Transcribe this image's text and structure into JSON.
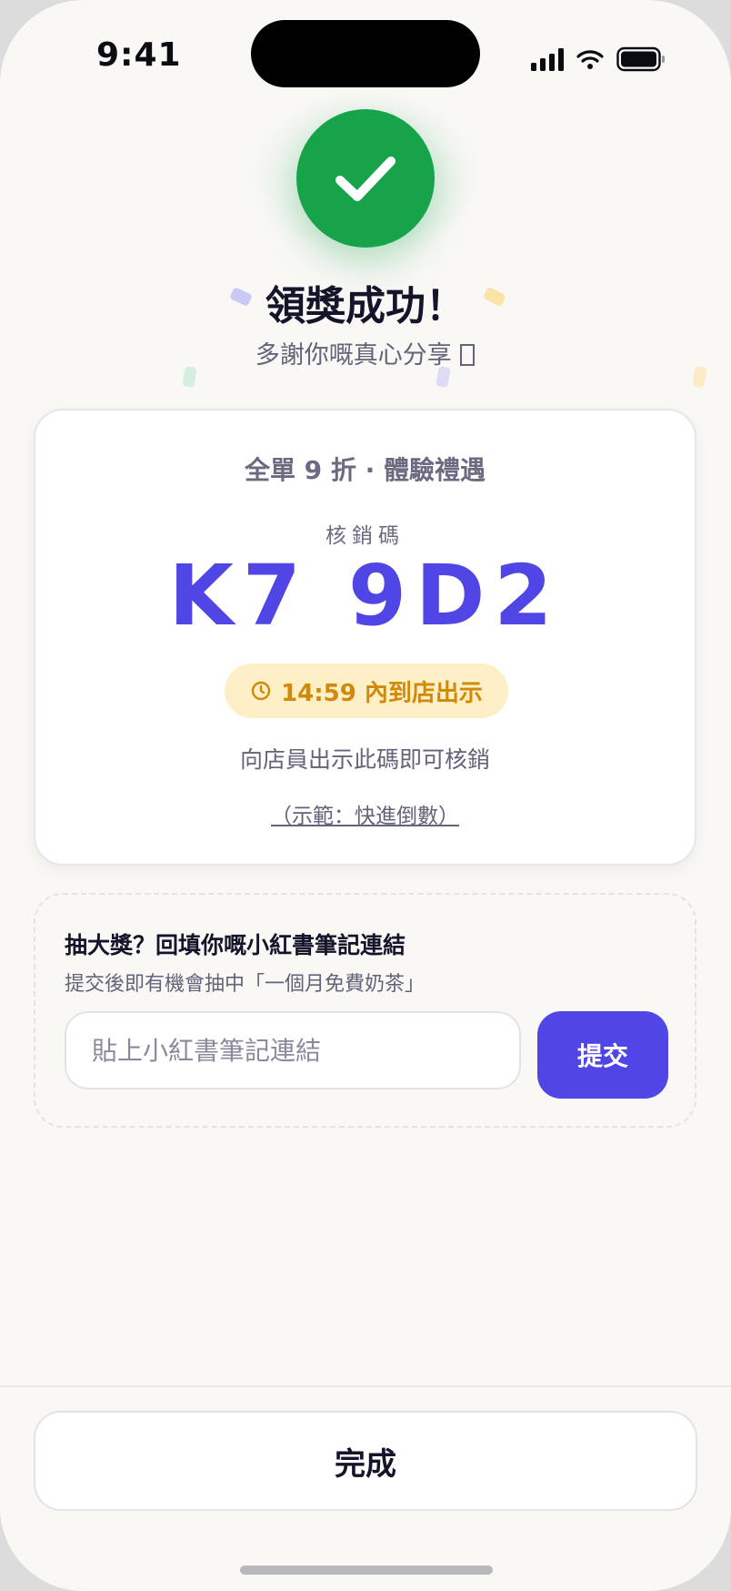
{
  "status_bar": {
    "time": "9:41",
    "icons": [
      "cellular-signal-icon",
      "wifi-icon",
      "battery-icon"
    ]
  },
  "header": {
    "success_icon": "checkmark-icon",
    "title": "領獎成功！",
    "subtitle": "多謝你嘅真心分享 ",
    "subtitle_emoji_icon": "emoji-glyph-icon"
  },
  "voucher": {
    "offer_name": "全單 9 折 · 體驗禮遇",
    "code_label": "核銷碼",
    "code": "K7 9D2",
    "timer_icon": "clock-icon",
    "timer_text": "14:59 內到店出示",
    "instruction": "向店員出示此碼即可核銷",
    "demo_link": "（示範：快進倒數）"
  },
  "lucky_draw": {
    "title": "抽大獎？回填你嘅小紅書筆記連結",
    "description": "提交後即有機會抽中「一個月免費奶茶」",
    "input_value": "",
    "input_placeholder": "貼上小紅書筆記連結",
    "submit_label": "提交"
  },
  "footer": {
    "done_label": "完成"
  },
  "colors": {
    "background": "#f9f8f5",
    "success": "#16a34a",
    "accent": "#4f46e5",
    "timer_bg": "#feefc6",
    "timer_text": "#d08a0a",
    "heading": "#14142b",
    "muted": "#63637a"
  }
}
